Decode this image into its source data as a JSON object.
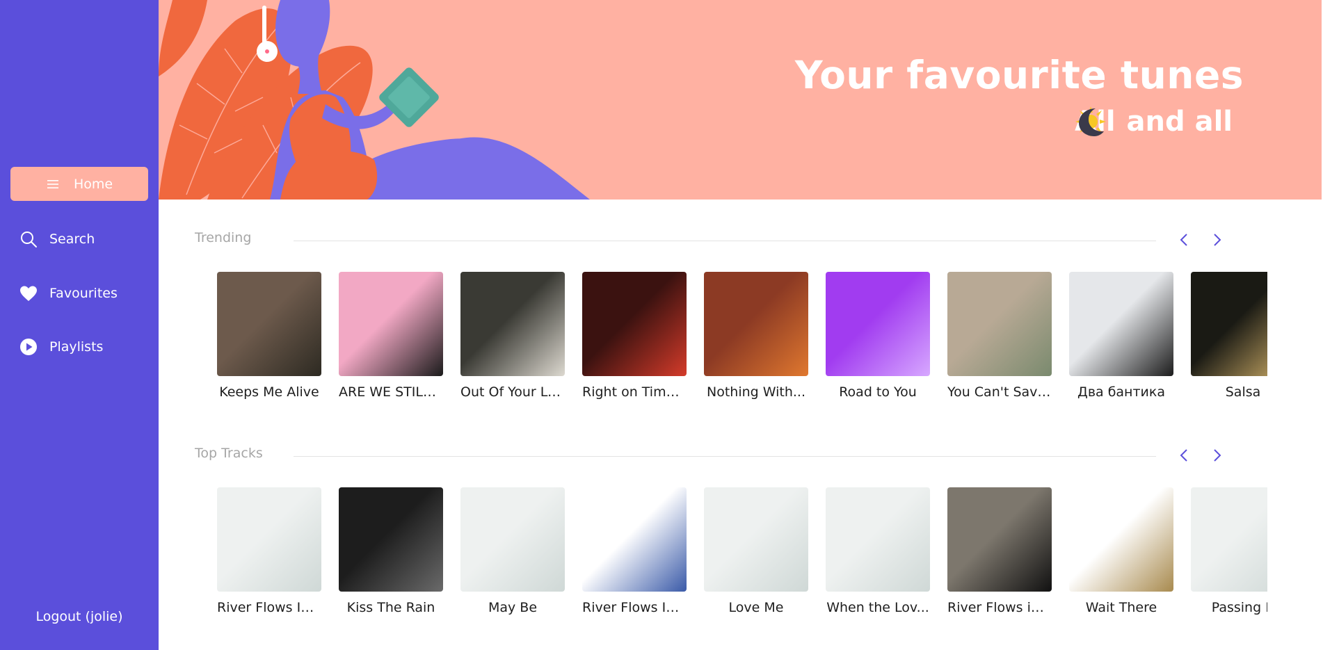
{
  "sidebar": {
    "items": [
      {
        "label": "Home",
        "icon": "menu-icon",
        "active": true
      },
      {
        "label": "Search",
        "icon": "search-icon"
      },
      {
        "label": "Favourites",
        "icon": "heart-icon"
      },
      {
        "label": "Playlists",
        "icon": "play-circle-icon"
      }
    ],
    "logout_label": "Logout (jolie)"
  },
  "banner": {
    "title": "Your favourite tunes",
    "subtitle_part1": "All",
    "subtitle_part2": "and all",
    "sun_icon": "sun-icon",
    "moon_icon": "moon-icon"
  },
  "trending": {
    "title": "Trending",
    "items": [
      {
        "title": "Keeps Me Alive",
        "colors": [
          "#6d5a4c",
          "#2d2a22"
        ]
      },
      {
        "title": "ARE WE STILL ...",
        "colors": [
          "#f2a8c4",
          "#1b1b1b"
        ]
      },
      {
        "title": "Out Of Your Le...",
        "colors": [
          "#3a3a34",
          "#ddd9d0"
        ]
      },
      {
        "title": "Right on Time ...",
        "colors": [
          "#3b1210",
          "#d43b2a"
        ]
      },
      {
        "title": "Nothing With...",
        "colors": [
          "#8c3a24",
          "#e0782f"
        ]
      },
      {
        "title": "Road to You",
        "colors": [
          "#a13cf0",
          "#d7a8ff"
        ]
      },
      {
        "title": "You Can't Save...",
        "colors": [
          "#b8a995",
          "#7a8a6e"
        ]
      },
      {
        "title": "Два бантика",
        "colors": [
          "#e5e7ea",
          "#1c1c1c"
        ]
      },
      {
        "title": "Salsa",
        "colors": [
          "#1a1a14",
          "#d4b26a"
        ]
      }
    ]
  },
  "top_tracks": {
    "title": "Top Tracks",
    "items": [
      {
        "title": "River Flows In ...",
        "colors": [
          "#eef1f0",
          "#cfd8d6"
        ]
      },
      {
        "title": "Kiss The Rain",
        "colors": [
          "#1d1d1d",
          "#6a6a6a"
        ]
      },
      {
        "title": "May Be",
        "colors": [
          "#eef1f0",
          "#cfd8d6"
        ]
      },
      {
        "title": "River Flows In ...",
        "colors": [
          "#ffffff",
          "#3a5aa8"
        ]
      },
      {
        "title": "Love Me",
        "colors": [
          "#eef1f0",
          "#cfd8d6"
        ]
      },
      {
        "title": "When the Lov...",
        "colors": [
          "#eef1f0",
          "#cfd8d6"
        ]
      },
      {
        "title": "River Flows in ...",
        "colors": [
          "#7d776d",
          "#111111"
        ]
      },
      {
        "title": "Wait There",
        "colors": [
          "#ffffff",
          "#a88a4e"
        ]
      },
      {
        "title": "Passing B",
        "colors": [
          "#eef1f0",
          "#cfd8d6"
        ]
      }
    ]
  }
}
